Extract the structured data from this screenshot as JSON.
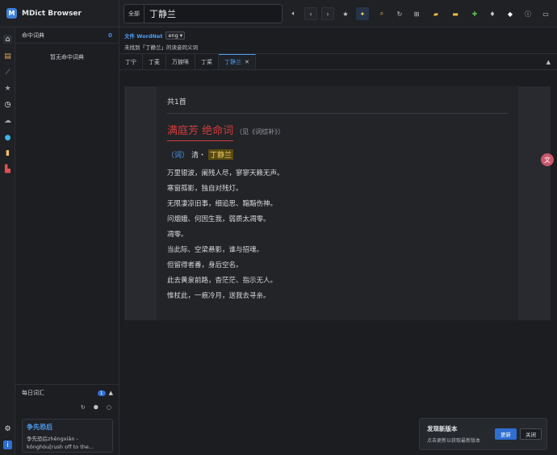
{
  "app": {
    "title": "MDict Browser",
    "logo_letter": "M"
  },
  "rail": [
    "home-icon",
    "dictionary-icon",
    "tag-icon",
    "star-icon",
    "history-icon",
    "cloud-icon",
    "globe-icon",
    "notebook-icon",
    "chart-icon",
    "settings-icon",
    "info-icon"
  ],
  "sidebar": {
    "hit_dicts_label": "命中词典",
    "hit_dicts_count": "0",
    "empty_text": "暂无命中词典",
    "daily_label": "每日词汇",
    "daily_badge": "1",
    "daily_word": "争先恐后",
    "daily_definition": "争先恐后zhēngxiān - kǒnghòu[rush off to the..."
  },
  "toolbar": {
    "scope": "全部",
    "query": "丁静兰",
    "icons": [
      "speaker-icon",
      "back-icon",
      "forward-icon",
      "star-icon",
      "sparkle-icon",
      "search-icon",
      "refresh-icon",
      "grid-icon",
      "lock-icon",
      "folder-icon",
      "puzzle-icon",
      "diamond-icon",
      "eraser-icon",
      "info-icon",
      "collapse-icon"
    ]
  },
  "subbar": {
    "dict_label": "文件 WordNet",
    "lang": "eng",
    "not_found": "未找到「丁静兰」的读音同义词"
  },
  "tabs": [
    "丁宁",
    "丁麦",
    "万捩咪",
    "丁桨",
    "丁静兰"
  ],
  "active_tab": 4,
  "article": {
    "count": "共1首",
    "title": "满庭芳  绝命词",
    "ref": "（见《词综补》）",
    "genre": "（词）",
    "dynasty": "清・",
    "author": "丁静兰",
    "lines": [
      "万里银波，阑残人尽，寥寥天籁无声。",
      "寒窗孤影，独自对残灯。",
      "无限凄凉旧事，细追思、黯黯伤神。",
      "问烟娥、何因生我，弱质太凋零。",
      "凋零。",
      "当此际、空梁悬影，谁与招魂。",
      "但留得者番，身后空名。",
      "此去黄泉前路，杳茫茫、指示无人。",
      "惟杖此，一痕冷月，送我去寻亲。"
    ]
  },
  "update": {
    "title": "发现新版本",
    "desc": "点击更新以获取最新版本",
    "update_label": "更新",
    "close_label": "关闭"
  },
  "colors": {
    "accent": "#4f9cf0",
    "title_red": "#d23c3c",
    "author_hl": "#5a4a10"
  }
}
